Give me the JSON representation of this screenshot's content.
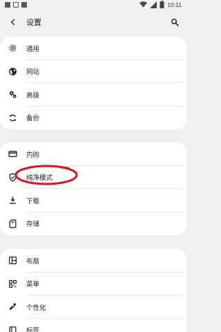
{
  "status_bar": {
    "time": "10:11"
  },
  "header": {
    "title": "设置"
  },
  "card1": {
    "items": [
      {
        "label": "通用",
        "icon": "gear-icon"
      },
      {
        "label": "网站",
        "icon": "globe-icon"
      },
      {
        "label": "高级",
        "icon": "gears-icon"
      },
      {
        "label": "备份",
        "icon": "sync-icon"
      }
    ]
  },
  "card2": {
    "items": [
      {
        "label": "内购",
        "icon": "credit-card-icon"
      },
      {
        "label": "纯净模式",
        "icon": "shield-icon"
      },
      {
        "label": "下载",
        "icon": "download-icon"
      },
      {
        "label": "存储",
        "icon": "sd-card-icon"
      }
    ]
  },
  "card3": {
    "items": [
      {
        "label": "布局",
        "icon": "layout-icon"
      },
      {
        "label": "菜单",
        "icon": "qr-menu-icon"
      },
      {
        "label": "个性化",
        "icon": "wrench-icon"
      },
      {
        "label": "标签",
        "icon": "tabs-icon"
      }
    ]
  },
  "colors": {
    "background": "#f0f0f0",
    "card": "#ffffff",
    "annotation": "#e0101a"
  }
}
